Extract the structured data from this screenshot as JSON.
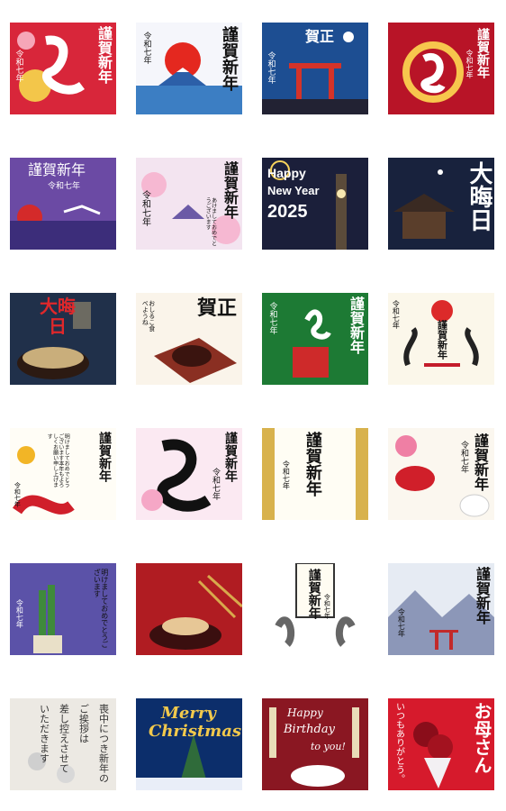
{
  "tiles": [
    {
      "id": "t01",
      "texts": [
        "謹賀新年",
        "令和七年"
      ]
    },
    {
      "id": "t02",
      "texts": [
        "謹賀新年",
        "令和七年"
      ]
    },
    {
      "id": "t03",
      "texts": [
        "賀正",
        "令和七年"
      ]
    },
    {
      "id": "t04",
      "texts": [
        "謹賀新年",
        "令和七年"
      ]
    },
    {
      "id": "t05",
      "texts": [
        "謹賀新年",
        "令和七年"
      ]
    },
    {
      "id": "t06",
      "texts": [
        "謹賀新年",
        "令和七年",
        "あけましておめでとうございます"
      ]
    },
    {
      "id": "t07",
      "texts": [
        "Happy",
        "New Year",
        "2025"
      ]
    },
    {
      "id": "t08",
      "texts": [
        "大晦日"
      ]
    },
    {
      "id": "t09",
      "texts": [
        "大晦日"
      ]
    },
    {
      "id": "t10",
      "texts": [
        "賀正",
        "おしるこ食べようね"
      ]
    },
    {
      "id": "t11",
      "texts": [
        "謹賀新年",
        "令和七年"
      ]
    },
    {
      "id": "t12",
      "texts": [
        "謹賀新年",
        "令和七年"
      ]
    },
    {
      "id": "t13",
      "texts": [
        "謹賀新年",
        "令和七年",
        "明けましておめでとうございます本年もよろしくお願い申し上げます"
      ]
    },
    {
      "id": "t14",
      "texts": [
        "謹賀新年",
        "令和七年"
      ]
    },
    {
      "id": "t15",
      "texts": [
        "謹賀新年",
        "令和七年"
      ]
    },
    {
      "id": "t16",
      "texts": [
        "謹賀新年",
        "令和七年"
      ]
    },
    {
      "id": "t17",
      "texts": [
        "明けましておめでとうございます",
        "令和七年"
      ]
    },
    {
      "id": "t18",
      "texts": []
    },
    {
      "id": "t19",
      "texts": [
        "謹賀新年",
        "令和七年"
      ]
    },
    {
      "id": "t20",
      "texts": [
        "謹賀新年",
        "令和七年"
      ]
    },
    {
      "id": "t21",
      "texts": [
        "喪中につき新年の",
        "ご挨拶は",
        "差し控えさせて",
        "いただきます"
      ]
    },
    {
      "id": "t22",
      "texts": [
        "Merry",
        "Christmas"
      ]
    },
    {
      "id": "t23",
      "texts": [
        "Happy",
        "Birthday",
        "to you!"
      ]
    },
    {
      "id": "t24",
      "texts": [
        "お母さん",
        "いつもありがとう。"
      ]
    }
  ]
}
